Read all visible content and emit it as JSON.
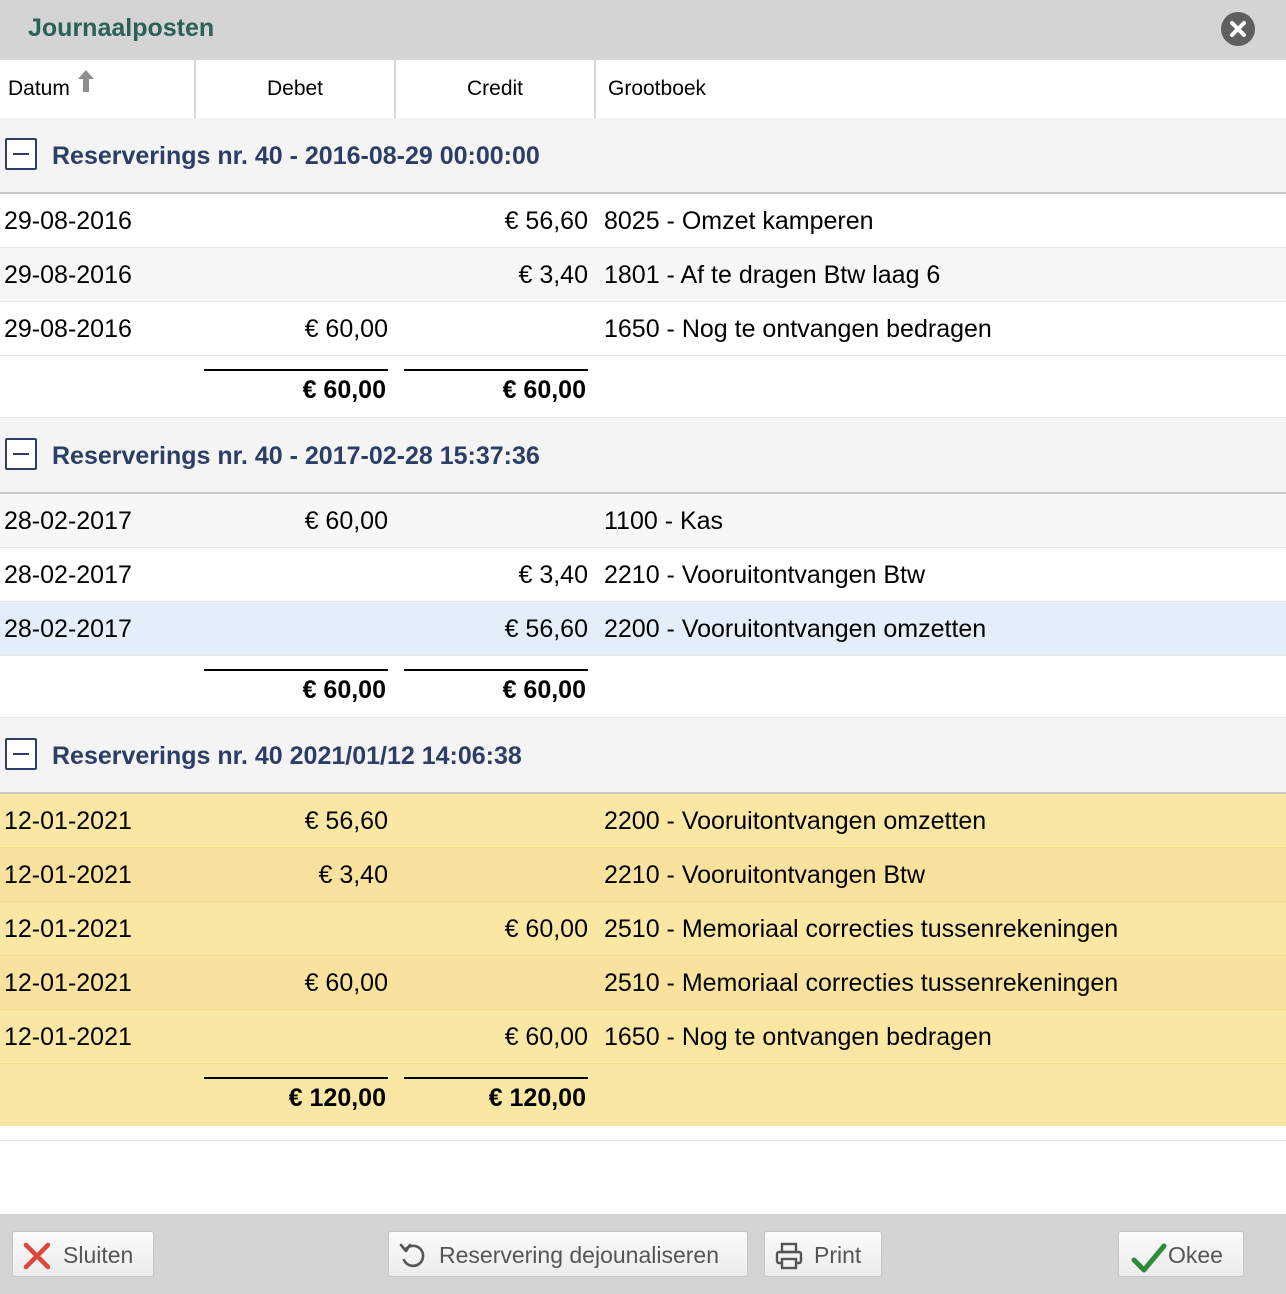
{
  "dialog": {
    "title": "Journaalposten"
  },
  "columns": {
    "datum": "Datum",
    "debet": "Debet",
    "credit": "Credit",
    "grootboek": "Grootboek"
  },
  "groups": [
    {
      "title": "Reserverings nr. 40 - 2016-08-29 00:00:00",
      "rows": [
        {
          "date": "29-08-2016",
          "debet": "",
          "credit": "€ 56,60",
          "ledger": "8025 - Omzet kamperen"
        },
        {
          "date": "29-08-2016",
          "debet": "",
          "credit": "€ 3,40",
          "ledger": "1801 - Af te dragen Btw laag 6"
        },
        {
          "date": "29-08-2016",
          "debet": "€ 60,00",
          "credit": "",
          "ledger": "1650 - Nog te ontvangen bedragen"
        }
      ],
      "total_debet": "€ 60,00",
      "total_credit": "€ 60,00"
    },
    {
      "title": "Reserverings nr. 40 - 2017-02-28 15:37:36",
      "rows": [
        {
          "date": "28-02-2017",
          "debet": "€ 60,00",
          "credit": "",
          "ledger": "1100 - Kas"
        },
        {
          "date": "28-02-2017",
          "debet": "",
          "credit": "€ 3,40",
          "ledger": "2210 - Vooruitontvangen Btw"
        },
        {
          "date": "28-02-2017",
          "debet": "",
          "credit": "€ 56,60",
          "ledger": "2200 - Vooruitontvangen omzetten"
        }
      ],
      "total_debet": "€ 60,00",
      "total_credit": "€ 60,00"
    },
    {
      "title": "Reserverings nr. 40 2021/01/12 14:06:38",
      "rows": [
        {
          "date": "12-01-2021",
          "debet": "€ 56,60",
          "credit": "",
          "ledger": "2200 - Vooruitontvangen omzetten"
        },
        {
          "date": "12-01-2021",
          "debet": "€ 3,40",
          "credit": "",
          "ledger": "2210 - Vooruitontvangen Btw"
        },
        {
          "date": "12-01-2021",
          "debet": "",
          "credit": "€ 60,00",
          "ledger": "2510 - Memoriaal correcties tussenrekeningen"
        },
        {
          "date": "12-01-2021",
          "debet": "€ 60,00",
          "credit": "",
          "ledger": "2510 - Memoriaal correcties tussenrekeningen"
        },
        {
          "date": "12-01-2021",
          "debet": "",
          "credit": "€ 60,00",
          "ledger": "1650 - Nog te ontvangen bedragen"
        }
      ],
      "total_debet": "€ 120,00",
      "total_credit": "€ 120,00"
    }
  ],
  "footer": {
    "close_label": "Sluiten",
    "dejournal_label": "Reservering dejounaliseren",
    "print_label": "Print",
    "ok_label": "Okee"
  },
  "colors": {
    "title_green": "#2c5f55",
    "group_navy": "#2c3e66",
    "highlight_yellow": "#fbe7a4",
    "selected_blue": "#e3eef8",
    "close_red": "#e0443a",
    "ok_green": "#2e8b3a"
  },
  "icons": {
    "close": "close-circle-icon",
    "sort": "sort-up-arrow-icon",
    "collapse": "collapse-minus-icon",
    "sluiten": "red-x-icon",
    "dejournal": "undo-arrow-icon",
    "print": "printer-icon",
    "ok": "checkmark-icon"
  }
}
